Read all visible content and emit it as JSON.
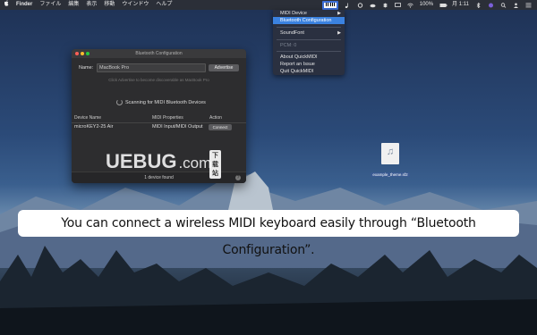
{
  "menubar": {
    "apple": "",
    "app": "Finder",
    "items": [
      "ファイル",
      "編集",
      "表示",
      "移動",
      "ウインドウ",
      "ヘルプ"
    ],
    "clock": "月 1:11",
    "battery": "100%"
  },
  "quickmidi_menu": {
    "items": [
      {
        "label": "MIDI Device",
        "submenu": true
      },
      {
        "label": "Bluetooth Configuration",
        "highlighted": true
      },
      {
        "label": "SoundFont",
        "submenu": true
      },
      {
        "label": "PCM: 0",
        "disabled": true
      },
      {
        "label": "About QuickMIDI"
      },
      {
        "label": "Report an Issue"
      },
      {
        "label": "Quit QuickMIDI"
      }
    ]
  },
  "bt_window": {
    "title": "Bluetooth Configuration",
    "name_label": "Name:",
    "name_value": "MacBook Pro",
    "advertise_button": "Advertise",
    "hint": "Click Advertise to become discoverable as MacBook Pro",
    "scanning_label": "Scanning for MIDI Bluetooth Devices",
    "columns": [
      "Device Name",
      "MIDI Properties",
      "Action"
    ],
    "rows": [
      {
        "device": "microKEY2-25 Air",
        "properties": "MIDI Input/MIDI Output",
        "action": "Connect"
      }
    ],
    "footer": "1 device found",
    "help": "?"
  },
  "watermark": {
    "text": "UEBUG",
    "suffix": ".com",
    "badge": "下载站"
  },
  "desktop_file": {
    "name": "example_theme.sf2"
  },
  "caption": "You can connect a wireless MIDI keyboard easily through “Bluetooth Configuration”.",
  "colors": {
    "highlight": "#3b82e0",
    "menubar": "#2b2f38",
    "window": "#2d2d2f"
  }
}
